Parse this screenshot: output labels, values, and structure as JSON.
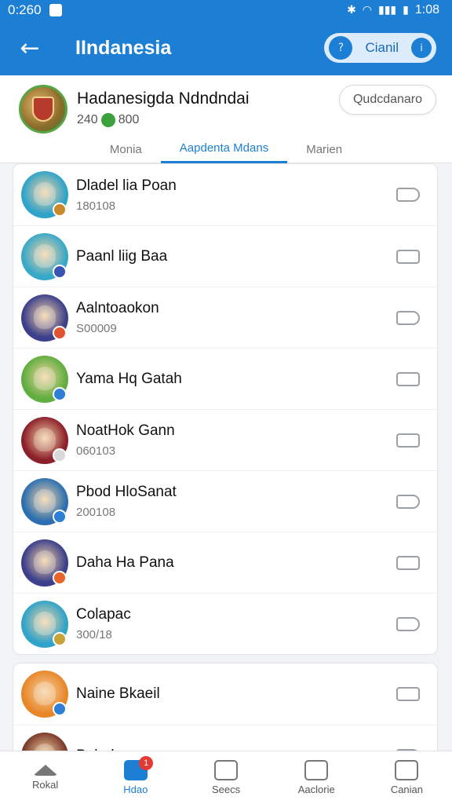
{
  "status_bar": {
    "time": "0:260",
    "right_time": "1:08"
  },
  "app_bar": {
    "title": "IIndanesia",
    "action_label": "Cianil"
  },
  "profile": {
    "name": "Hadanesigda Ndndndai",
    "stats_left": "240",
    "stats_right": "800",
    "button_label": "Qudcdanaro"
  },
  "tabs": [
    {
      "label": "Monia",
      "active": false
    },
    {
      "label": "Aapdenta Mdans",
      "active": true
    },
    {
      "label": "Marien",
      "active": false
    }
  ],
  "list_items": [
    {
      "name": "Dladel lia Poan",
      "sub": "180108",
      "avatar_color": "#2fa3c9",
      "badge_color": "#c98a2a",
      "tag": "arrow"
    },
    {
      "name": "Paanl liig Baa",
      "sub": "",
      "avatar_color": "#38a8c8",
      "badge_color": "#3a54b5",
      "tag": "box"
    },
    {
      "name": "Aalntoaokon",
      "sub": "S00009",
      "avatar_color": "#3b3f8c",
      "badge_color": "#e0532e",
      "tag": "arrow"
    },
    {
      "name": "Yama Hq Gatah",
      "sub": "",
      "avatar_color": "#5fae3f",
      "badge_color": "#2e7fd6",
      "tag": "box"
    },
    {
      "name": "NoatHok Gann",
      "sub": "060103",
      "avatar_color": "#8b1f2b",
      "badge_color": "#d9d9d9",
      "tag": "box"
    },
    {
      "name": "Pbod HloSanat",
      "sub": "200108",
      "avatar_color": "#2c6fb0",
      "badge_color": "#2e7fd6",
      "tag": "arrow"
    },
    {
      "name": "Daha Ha Pana",
      "sub": "",
      "avatar_color": "#3b3f8c",
      "badge_color": "#e8642a",
      "tag": "box"
    },
    {
      "name": "Colapac",
      "sub": "300/18",
      "avatar_color": "#2fa3c9",
      "badge_color": "#c9a23a",
      "tag": "arrow"
    },
    {
      "name": "Naine Bkaeil",
      "sub": "",
      "avatar_color": "#e8862a",
      "badge_color": "#2e7fd6",
      "tag": "box"
    },
    {
      "name": "Pabalo",
      "sub": "",
      "avatar_color": "#7a3a2a",
      "badge_color": "#c9a23a",
      "tag": "arrow"
    }
  ],
  "bottom_nav": [
    {
      "label": "Rokal",
      "active": false,
      "icon": "home-icon"
    },
    {
      "label": "Hdao",
      "active": true,
      "icon": "chat-icon",
      "badge": "1"
    },
    {
      "label": "Seecs",
      "active": false,
      "icon": "list-icon"
    },
    {
      "label": "Aaclorie",
      "active": false,
      "icon": "store-icon"
    },
    {
      "label": "Canian",
      "active": false,
      "icon": "profile-icon"
    }
  ],
  "colors": {
    "primary": "#1d7fd4",
    "background": "#f2f3f5"
  }
}
